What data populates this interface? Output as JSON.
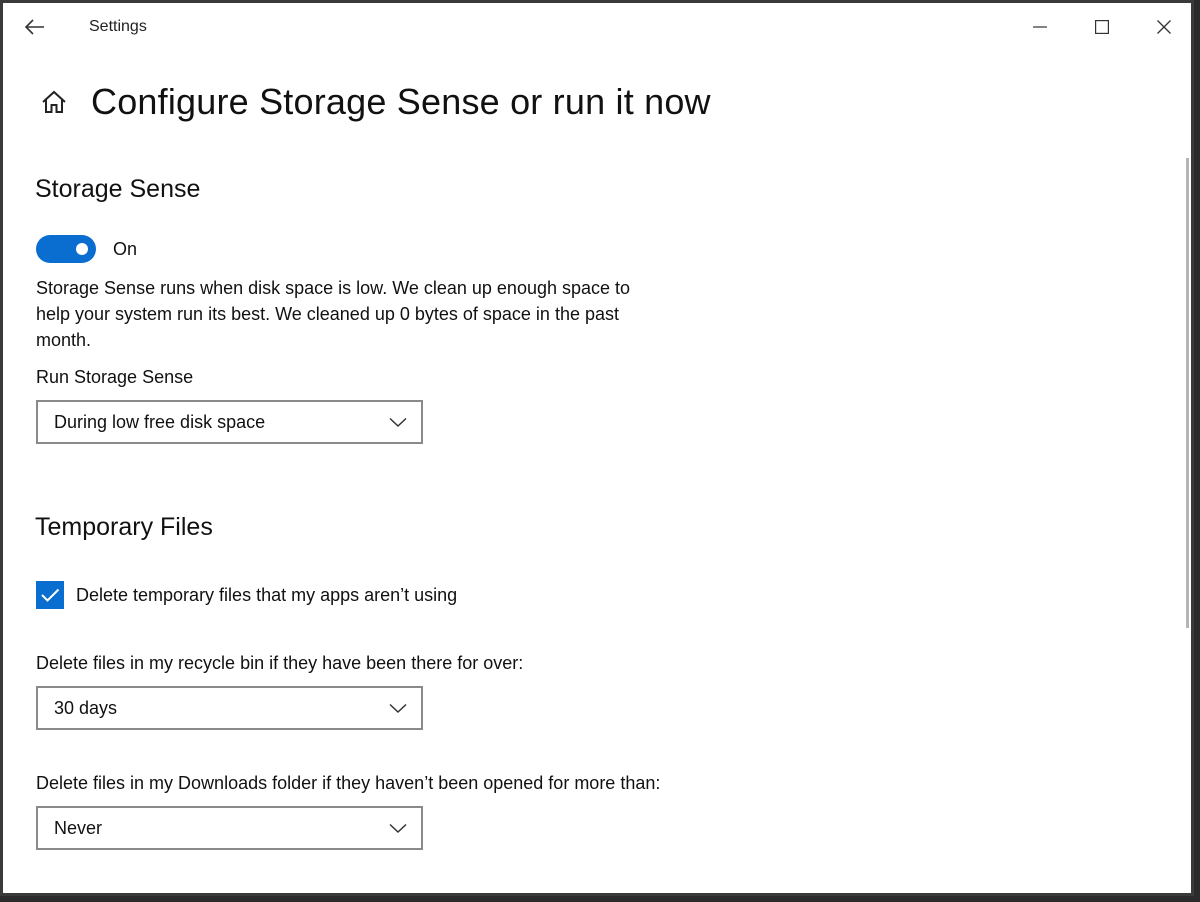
{
  "window": {
    "app_title": "Settings"
  },
  "page": {
    "title": "Configure Storage Sense or run it now"
  },
  "storage_sense": {
    "section_title": "Storage Sense",
    "toggle_state": "On",
    "description": "Storage Sense runs when disk space is low. We clean up enough space to help your system run its best. We cleaned up 0 bytes of space in the past month.",
    "run_label": "Run Storage Sense",
    "run_value": "During low free disk space"
  },
  "temporary_files": {
    "section_title": "Temporary Files",
    "delete_temp_label": "Delete temporary files that my apps aren’t using",
    "delete_temp_checked": true,
    "recycle_label": "Delete files in my recycle bin if they have been there for over:",
    "recycle_value": "30 days",
    "downloads_label": "Delete files in my Downloads folder if they haven’t been opened for more than:",
    "downloads_value": "Never"
  },
  "colors": {
    "accent": "#0a6ed1"
  },
  "icons": {
    "back": "back-arrow-icon",
    "home": "home-icon",
    "minimize": "minimize-icon",
    "maximize": "maximize-icon",
    "close": "close-icon",
    "dropdown": "chevron-down-icon",
    "check": "checkmark-icon"
  }
}
